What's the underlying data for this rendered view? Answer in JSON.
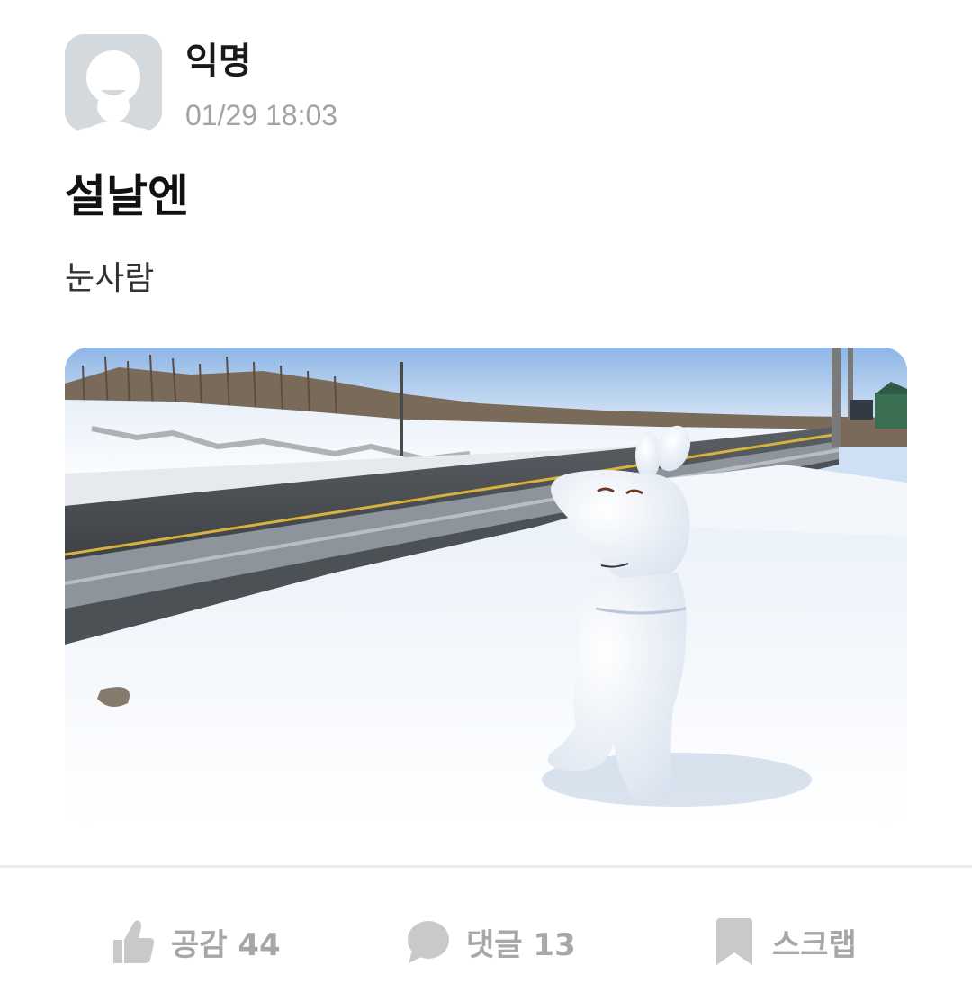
{
  "author": {
    "name": "익명",
    "time": "01/29 18:03",
    "avatar_icon": "anonymous-user-icon"
  },
  "post": {
    "title": "설날엔",
    "body": "눈사람",
    "image": {
      "subject": "snowman-photo"
    }
  },
  "actions": {
    "like": {
      "label": "공감 44",
      "icon": "thumbs-up-icon"
    },
    "comment": {
      "label": "댓글 13",
      "icon": "speech-bubble-icon"
    },
    "scrap": {
      "label": "스크랩",
      "icon": "bookmark-icon"
    }
  },
  "colors": {
    "icon_gray": "#c9c9c9",
    "label_gray": "#a7a7a7",
    "avatar_bg": "#d4d9dd"
  }
}
